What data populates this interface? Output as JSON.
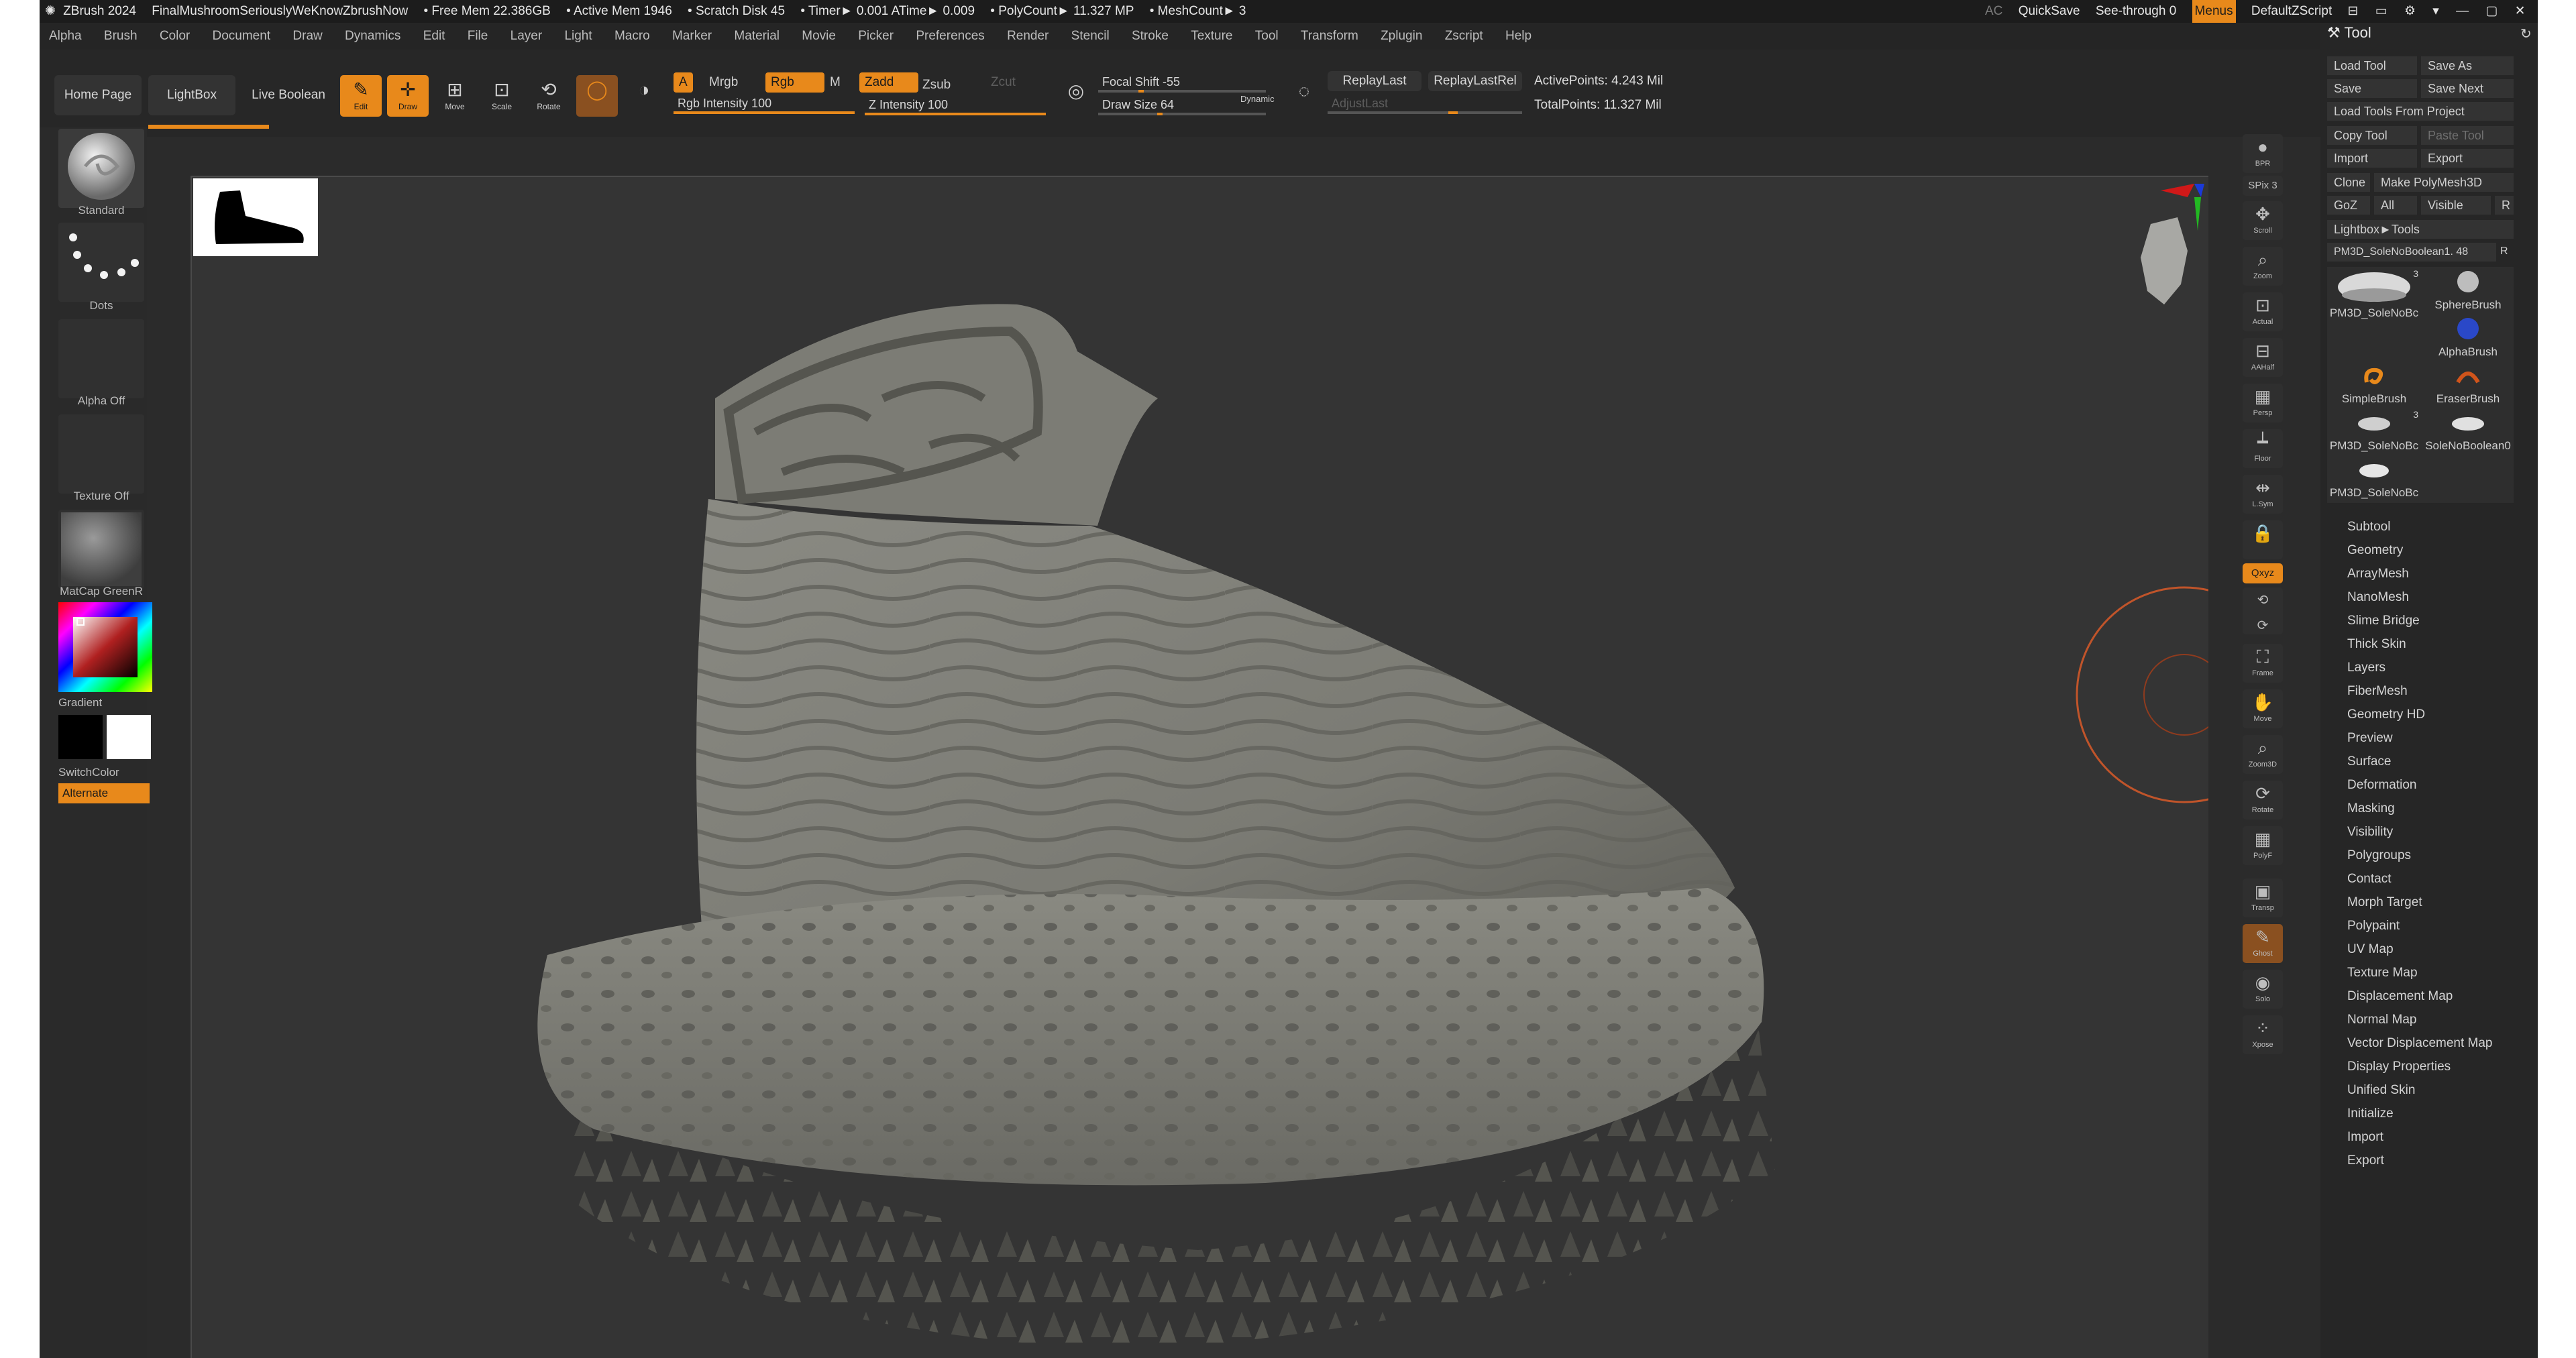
{
  "titlebar": {
    "app": "ZBrush 2024",
    "project": "FinalMushroomSeriouslyWeKnowZbrushNow",
    "free_mem": "• Free Mem 22.386GB",
    "active_mem": "• Active Mem 1946",
    "scratch": "• Scratch Disk 45",
    "timer": "• Timer► 0.001 ATime► 0.009",
    "polycount": "• PolyCount► 11.327 MP",
    "meshcount": "• MeshCount► 3",
    "ac": "AC",
    "quicksave": "QuickSave",
    "seethrough": "See-through  0",
    "menus": "Menus",
    "script": "DefaultZScript"
  },
  "menubar": [
    "Alpha",
    "Brush",
    "Color",
    "Document",
    "Draw",
    "Dynamics",
    "Edit",
    "File",
    "Layer",
    "Light",
    "Macro",
    "Marker",
    "Material",
    "Movie",
    "Picker",
    "Preferences",
    "Render",
    "Stencil",
    "Stroke",
    "Texture",
    "Tool",
    "Transform",
    "Zplugin",
    "Zscript",
    "Help"
  ],
  "shelf": {
    "home": "Home Page",
    "lightbox": "LightBox",
    "liveboolean": "Live Boolean",
    "edit": "Edit",
    "draw": "Draw",
    "move": "Move",
    "scale": "Scale",
    "rotate": "Rotate",
    "a": "A",
    "mrgb": "Mrgb",
    "rgb": "Rgb",
    "m": "M",
    "zadd": "Zadd",
    "zsub": "Zsub",
    "zcut": "Zcut",
    "rgb_intensity": "Rgb Intensity 100",
    "z_intensity": "Z Intensity 100",
    "focal_shift": "Focal Shift -55",
    "draw_size": "Draw Size 64",
    "dynamic": "Dynamic",
    "replaylast": "ReplayLast",
    "replaylastrel": "ReplayLastRel",
    "adjustlast": "AdjustLast",
    "activepoints": "ActivePoints: 4.243 Mil",
    "totalpoints": "TotalPoints: 11.327 Mil",
    "rgb_intensity_value": 100,
    "z_intensity_value": 100,
    "draw_size_fraction": 0.35
  },
  "lefttray": {
    "standard": "Standard",
    "dots": "Dots",
    "alpha": "Alpha Off",
    "texture": "Texture Off",
    "matcap": "MatCap GreenR",
    "gradient": "Gradient",
    "switchcolor": "SwitchColor",
    "alternate": "Alternate"
  },
  "iconstrip": [
    {
      "label": "BPR",
      "icon": "sphere-icon"
    },
    {
      "label": "SPix 3",
      "icon": "spix-icon"
    },
    {
      "label": "Scroll",
      "icon": "scroll-icon"
    },
    {
      "label": "Zoom",
      "icon": "zoom-icon"
    },
    {
      "label": "Actual",
      "icon": "actual-icon"
    },
    {
      "label": "AAHalf",
      "icon": "aahalf-icon"
    },
    {
      "label": "Persp",
      "icon": "persp-icon"
    },
    {
      "label": "Floor",
      "icon": "floor-icon"
    },
    {
      "label": "L.Sym",
      "icon": "lsym-icon"
    },
    {
      "label": "Qxyz",
      "icon": "xyz-icon"
    },
    {
      "label": "Frame",
      "icon": "frame-icon"
    },
    {
      "label": "Move",
      "icon": "move-icon"
    },
    {
      "label": "Zoom3D",
      "icon": "zoom3d-icon"
    },
    {
      "label": "Rotate",
      "icon": "rotate-icon"
    },
    {
      "label": "PolyF",
      "icon": "polyf-icon"
    },
    {
      "label": "Transp",
      "icon": "transp-icon"
    },
    {
      "label": "Ghost",
      "icon": "ghost-icon"
    },
    {
      "label": "Solo",
      "icon": "solo-icon"
    },
    {
      "label": "Xpose",
      "icon": "xpose-icon"
    }
  ],
  "palette": {
    "title": "Tool",
    "load": "Load Tool",
    "saveas": "Save As",
    "save": "Save",
    "savenext": "Save Next",
    "loadproject": "Load Tools From Project",
    "copy": "Copy Tool",
    "paste": "Paste Tool",
    "import": "Import",
    "export": "Export",
    "clone": "Clone",
    "makepoly": "Make PolyMesh3D",
    "goz": "GoZ",
    "all": "All",
    "visible": "Visible",
    "r": "R",
    "lightbox_tools": "Lightbox►Tools",
    "current_tool": "PM3D_SoleNoBoolean1. 48",
    "tools": [
      {
        "label": "PM3D_SoleNoBc",
        "badge": "3"
      },
      {
        "label": "SphereBrush",
        "badge": ""
      },
      {
        "label": "AlphaBrush",
        "badge": ""
      },
      {
        "label": "SimpleBrush",
        "badge": ""
      },
      {
        "label": "EraserBrush",
        "badge": ""
      },
      {
        "label": "PM3D_SoleNoBc",
        "badge": "3"
      },
      {
        "label": "SoleNoBoolean0",
        "badge": ""
      },
      {
        "label": "PM3D_SoleNoBc",
        "badge": ""
      }
    ],
    "subpalettes": [
      "Subtool",
      "Geometry",
      "ArrayMesh",
      "NanoMesh",
      "Slime Bridge",
      "Thick Skin",
      "Layers",
      "FiberMesh",
      "Geometry HD",
      "Preview",
      "Surface",
      "Deformation",
      "Masking",
      "Visibility",
      "Polygroups",
      "Contact",
      "Morph Target",
      "Polypaint",
      "UV Map",
      "Texture Map",
      "Displacement Map",
      "Normal Map",
      "Vector Displacement Map",
      "Display Properties",
      "Unified Skin",
      "Initialize",
      "Import",
      "Export"
    ]
  },
  "colors": {
    "accent": "#e8891b",
    "background": "#2b2b2b",
    "canvas": "#343434",
    "model": "#7f7f78"
  }
}
